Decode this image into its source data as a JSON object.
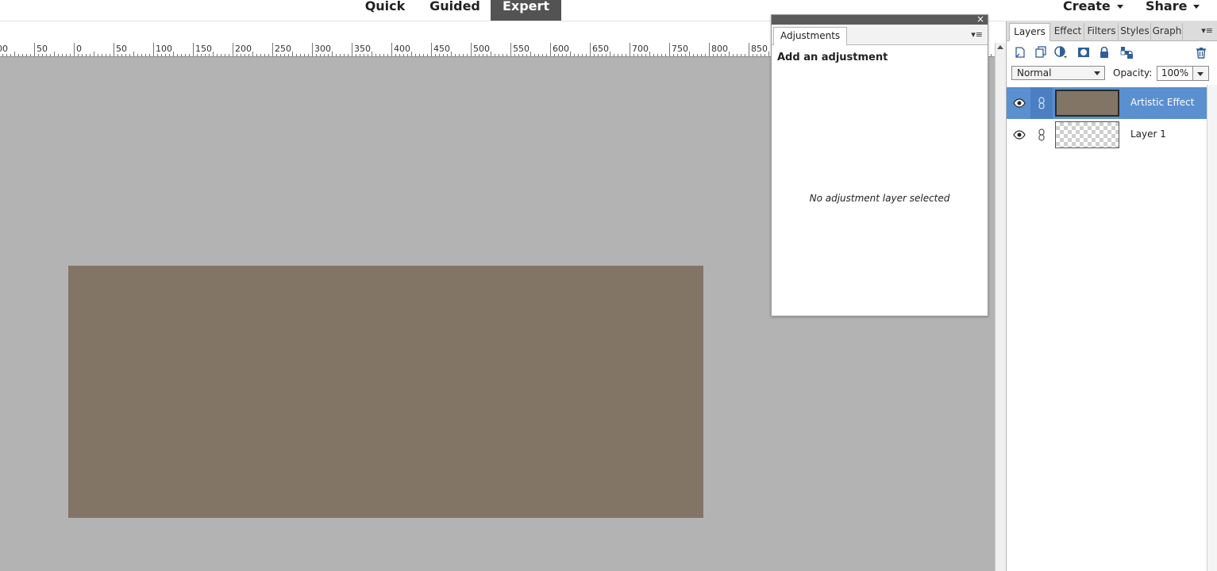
{
  "top_bar": {
    "modes": [
      {
        "label": "Quick",
        "active": false
      },
      {
        "label": "Guided",
        "active": false
      },
      {
        "label": "Expert",
        "active": true
      }
    ],
    "create_label": "Create",
    "share_label": "Share"
  },
  "ruler": {
    "labels": [
      "00",
      "50",
      "0",
      "50",
      "100",
      "150",
      "200",
      "250",
      "300",
      "350",
      "400",
      "450",
      "500",
      "550",
      "600",
      "650",
      "700",
      "750",
      "800",
      "850"
    ]
  },
  "canvas": {
    "background_color": "#b3b3b3",
    "image_color": "#837565"
  },
  "adjustments_panel": {
    "tab_label": "Adjustments",
    "menu_glyph": "▾≡",
    "close_glyph": "×",
    "heading": "Add an adjustment",
    "empty_message": "No adjustment layer selected"
  },
  "layers_panel": {
    "tabs": [
      {
        "label": "Layers",
        "active": true
      },
      {
        "label": "Effect",
        "active": false
      },
      {
        "label": "Filters",
        "active": false
      },
      {
        "label": "Styles",
        "active": false
      },
      {
        "label": "Graph",
        "active": false
      }
    ],
    "menu_glyph": "▾≡",
    "toolbar_icons": [
      "new-layer-icon",
      "new-group-icon",
      "adjustment-layer-icon",
      "layer-mask-icon",
      "lock-icon",
      "lock-transparency-icon",
      "trash-icon"
    ],
    "blend_mode": "Normal",
    "opacity_label": "Opacity:",
    "opacity_value": "100%",
    "selection_color": "#5a8fd0",
    "layers": [
      {
        "name": "Artistic Effect",
        "selected": true,
        "thumbnail": "solid"
      },
      {
        "name": "Layer 1",
        "selected": false,
        "thumbnail": "transparent"
      }
    ]
  }
}
